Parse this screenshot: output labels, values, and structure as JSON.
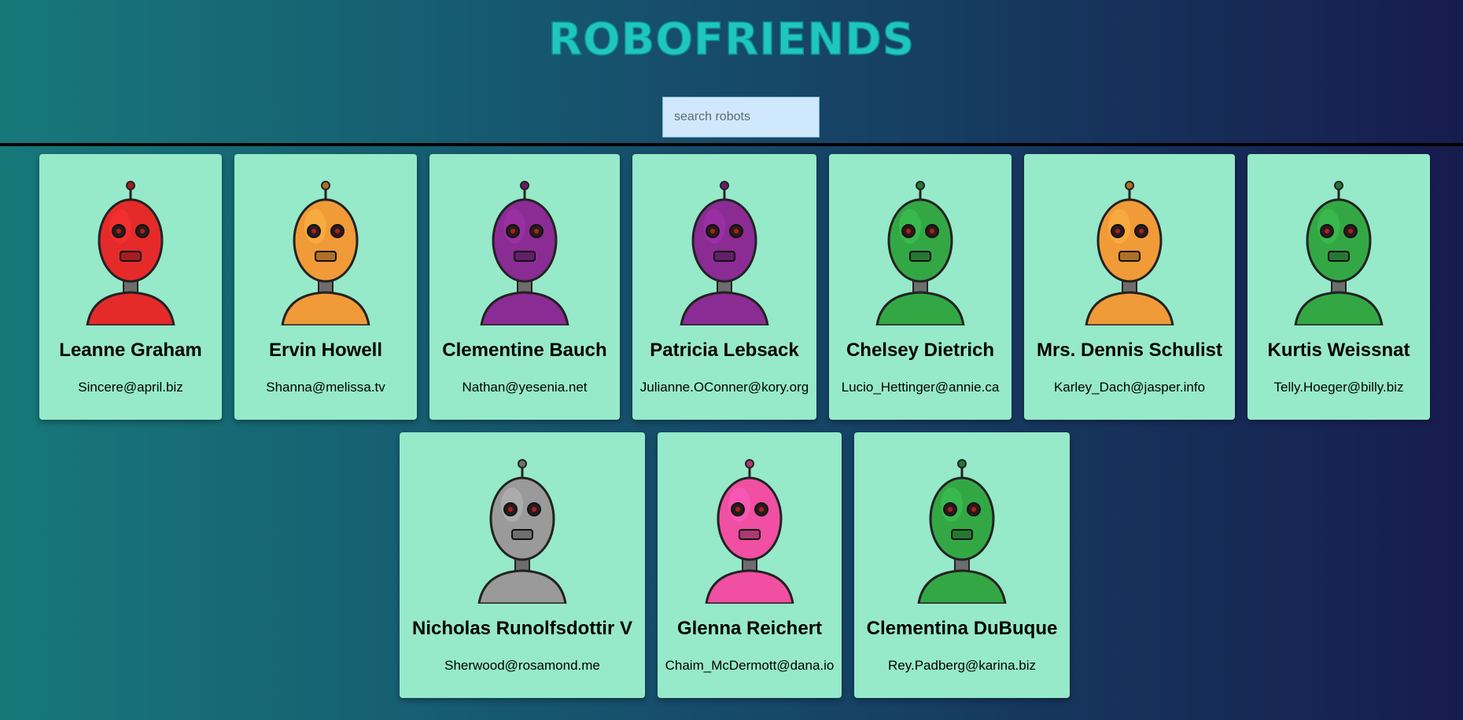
{
  "app": {
    "title": "ROBOFRIENDS"
  },
  "search": {
    "placeholder": "search robots",
    "value": ""
  },
  "robots": [
    {
      "name": "Leanne Graham",
      "email": "Sincere@april.biz",
      "color": "#e52a2a"
    },
    {
      "name": "Ervin Howell",
      "email": "Shanna@melissa.tv",
      "color": "#f19a38"
    },
    {
      "name": "Clementine Bauch",
      "email": "Nathan@yesenia.net",
      "color": "#8b2b94"
    },
    {
      "name": "Patricia Lebsack",
      "email": "Julianne.OConner@kory.org",
      "color": "#8b2b94"
    },
    {
      "name": "Chelsey Dietrich",
      "email": "Lucio_Hettinger@annie.ca",
      "color": "#34a745"
    },
    {
      "name": "Mrs. Dennis Schulist",
      "email": "Karley_Dach@jasper.info",
      "color": "#f19a38"
    },
    {
      "name": "Kurtis Weissnat",
      "email": "Telly.Hoeger@billy.biz",
      "color": "#34a745"
    },
    {
      "name": "Nicholas Runolfsdottir V",
      "email": "Sherwood@rosamond.me",
      "color": "#9a9a9a"
    },
    {
      "name": "Glenna Reichert",
      "email": "Chaim_McDermott@dana.io",
      "color": "#f04fa2"
    },
    {
      "name": "Clementina DuBuque",
      "email": "Rey.Padberg@karina.biz",
      "color": "#34a745"
    }
  ]
}
